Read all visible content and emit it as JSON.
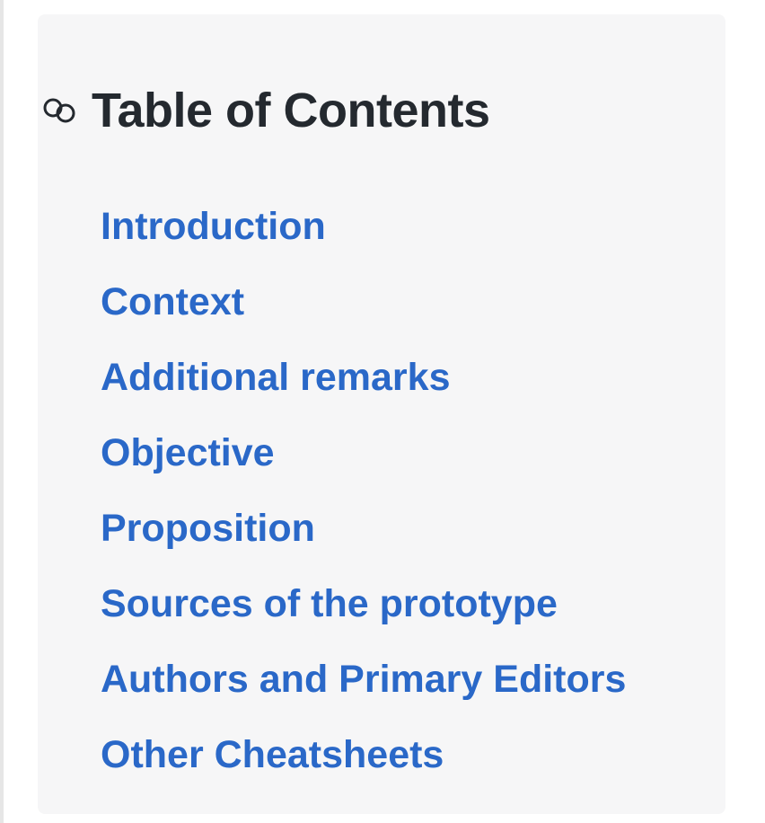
{
  "toc": {
    "heading": "Table of Contents",
    "items": [
      {
        "label": "Introduction"
      },
      {
        "label": "Context"
      },
      {
        "label": "Additional remarks"
      },
      {
        "label": "Objective"
      },
      {
        "label": "Proposition"
      },
      {
        "label": "Sources of the prototype"
      },
      {
        "label": "Authors and Primary Editors"
      },
      {
        "label": "Other Cheatsheets"
      }
    ]
  },
  "colors": {
    "link": "#2a68c8",
    "heading": "#24292f",
    "panel_background": "#f6f6f7"
  },
  "icons": {
    "heading_anchor": "link-icon"
  }
}
